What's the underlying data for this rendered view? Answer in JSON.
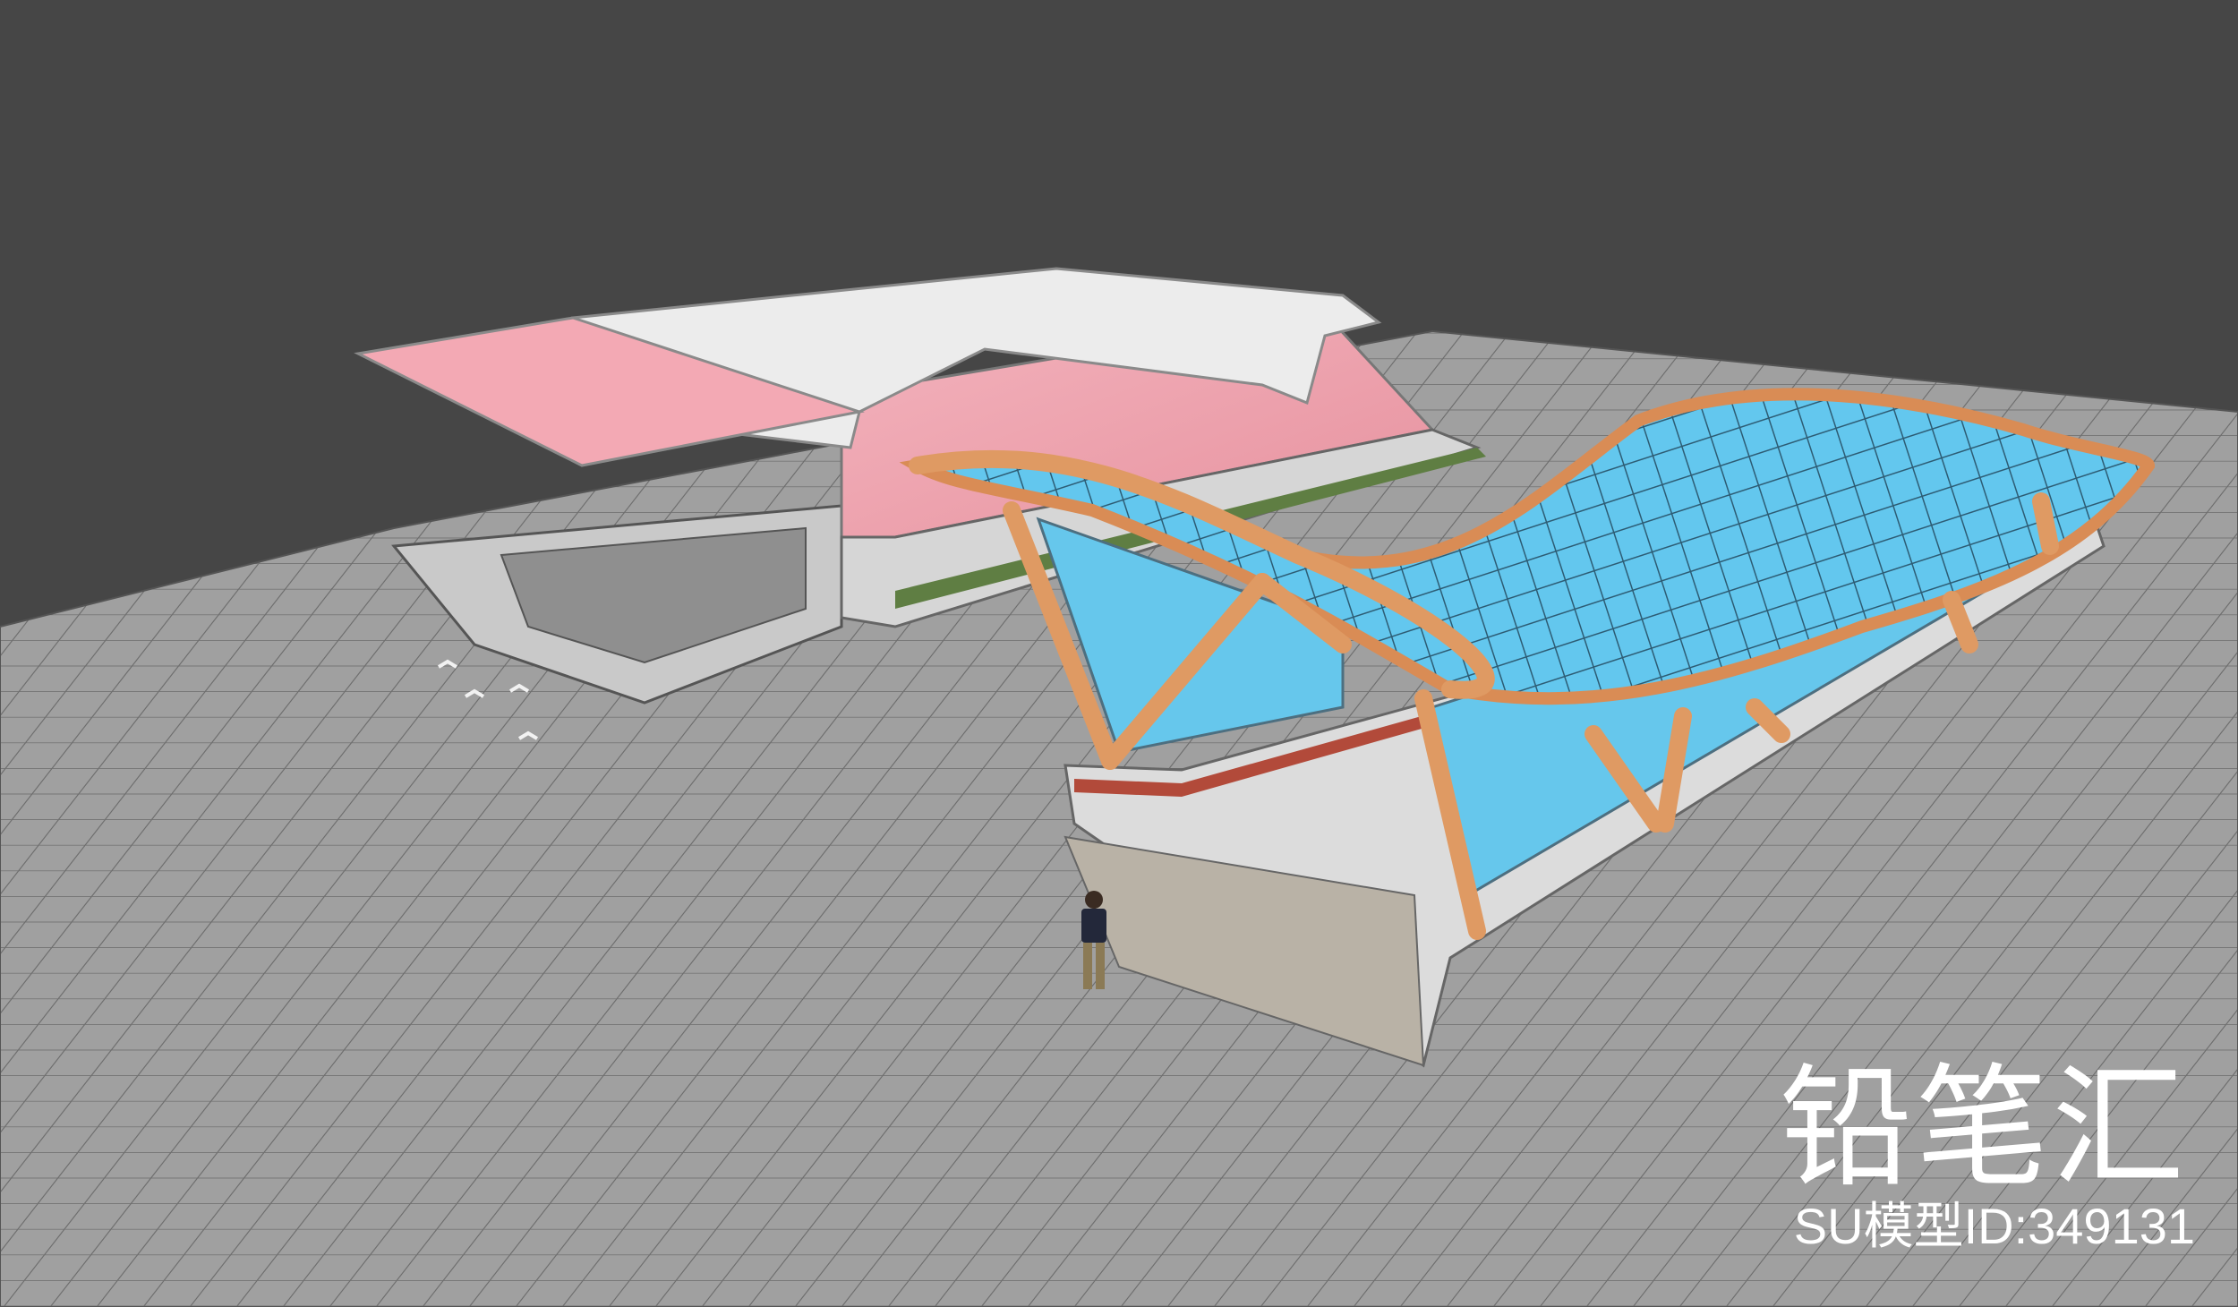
{
  "watermark": {
    "brand": "铅笔汇",
    "model_id": "SU模型ID:349131"
  },
  "colors": {
    "background": "#464646",
    "ground": "#9a9a9a",
    "ground_grid": "#6e6e6e",
    "glass_canopy": "#5ec4ec",
    "timber_frame": "#e09a62",
    "pink_glass": "#f0a7b2",
    "roof": "#e8e8e8"
  }
}
